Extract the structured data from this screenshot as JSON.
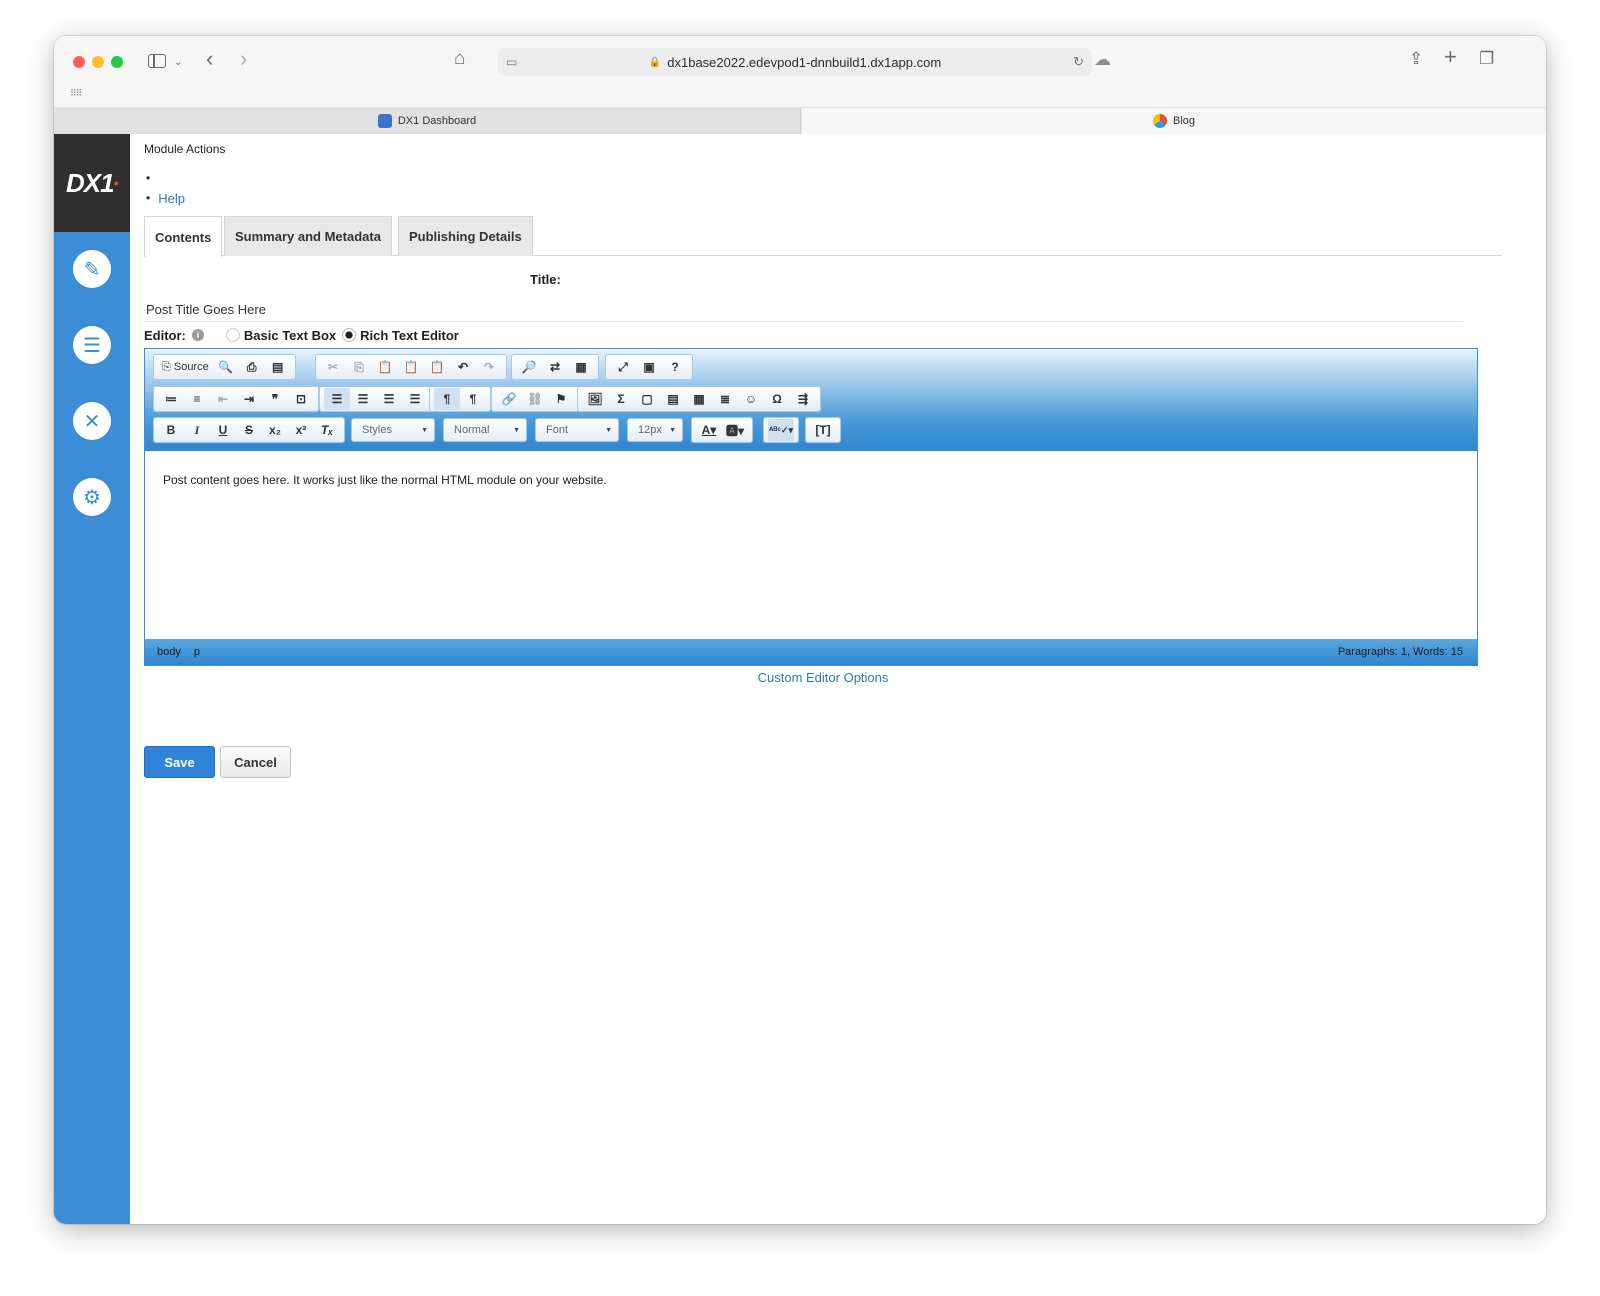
{
  "browser": {
    "url": "dx1base2022.edevpod1-dnnbuild1.dx1app.com",
    "tabs": [
      {
        "label": "DX1 Dashboard",
        "active": true
      },
      {
        "label": "Blog",
        "active": false
      }
    ]
  },
  "app": {
    "logo": "DX1",
    "sidebar_icons": [
      "pencil-icon",
      "document-icon",
      "tools-icon",
      "gear-icon"
    ]
  },
  "module": {
    "actions_label": "Module Actions",
    "help_label": "Help"
  },
  "tabs": [
    {
      "label": "Contents",
      "active": true
    },
    {
      "label": "Summary and Metadata",
      "active": false
    },
    {
      "label": "Publishing Details",
      "active": false
    }
  ],
  "form": {
    "title_label": "Title:",
    "title_value": "Post Title Goes Here",
    "editor_label": "Editor:",
    "editor_options": [
      {
        "label": "Basic Text Box",
        "selected": false
      },
      {
        "label": "Rich Text Editor",
        "selected": true
      }
    ]
  },
  "editor": {
    "source_label": "Source",
    "combos": {
      "styles": "Styles",
      "format": "Normal",
      "font": "Font",
      "size": "12px"
    },
    "content": "Post content goes here.  It works just like the normal HTML module on your website.",
    "path": [
      "body",
      "p"
    ],
    "stats": "Paragraphs: 1, Words: 15"
  },
  "links": {
    "custom_editor_options": "Custom Editor Options"
  },
  "buttons": {
    "save": "Save",
    "cancel": "Cancel"
  },
  "colors": {
    "sidebar": "#3d8dd6",
    "primary_button": "#2f84d9",
    "link": "#2a7ab8"
  }
}
